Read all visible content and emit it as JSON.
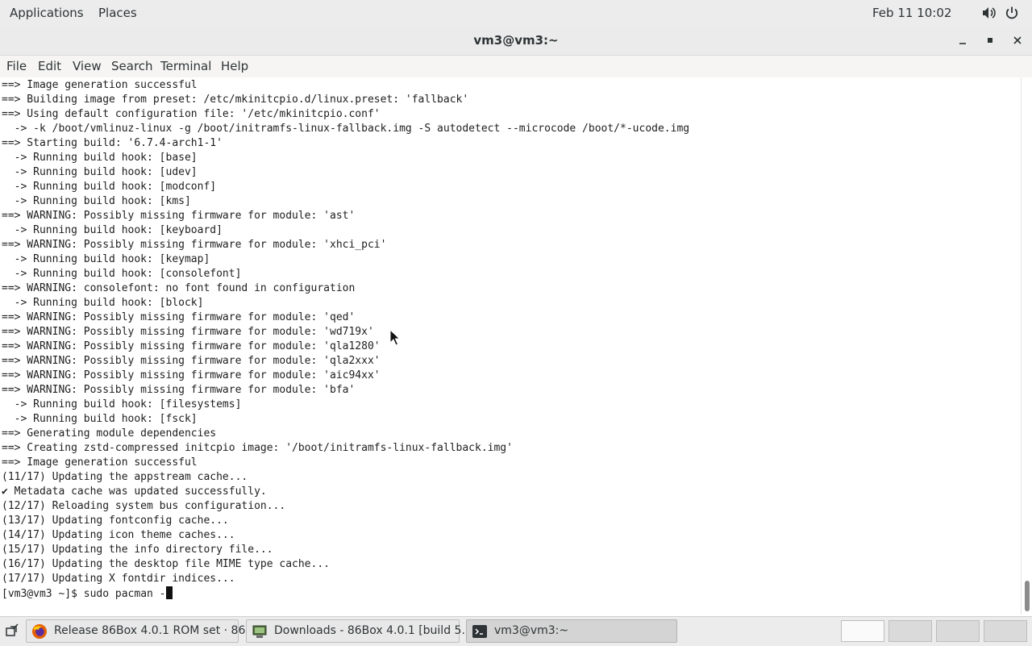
{
  "top_panel": {
    "applications": "Applications",
    "places": "Places",
    "clock": "Feb 11  10:02",
    "icons": [
      "volume-icon",
      "power-icon"
    ]
  },
  "window": {
    "title": "vm3@vm3:~",
    "buttons": [
      "minimize-icon",
      "maximize-icon",
      "close-icon"
    ]
  },
  "menubar": [
    "File",
    "Edit",
    "View",
    "Search",
    "Terminal",
    "Help"
  ],
  "terminal": {
    "lines": [
      "==> Image generation successful",
      "==> Building image from preset: /etc/mkinitcpio.d/linux.preset: 'fallback'",
      "==> Using default configuration file: '/etc/mkinitcpio.conf'",
      "  -> -k /boot/vmlinuz-linux -g /boot/initramfs-linux-fallback.img -S autodetect --microcode /boot/*-ucode.img",
      "==> Starting build: '6.7.4-arch1-1'",
      "  -> Running build hook: [base]",
      "  -> Running build hook: [udev]",
      "  -> Running build hook: [modconf]",
      "  -> Running build hook: [kms]",
      "==> WARNING: Possibly missing firmware for module: 'ast'",
      "  -> Running build hook: [keyboard]",
      "==> WARNING: Possibly missing firmware for module: 'xhci_pci'",
      "  -> Running build hook: [keymap]",
      "  -> Running build hook: [consolefont]",
      "==> WARNING: consolefont: no font found in configuration",
      "  -> Running build hook: [block]",
      "==> WARNING: Possibly missing firmware for module: 'qed'",
      "==> WARNING: Possibly missing firmware for module: 'wd719x'",
      "==> WARNING: Possibly missing firmware for module: 'qla1280'",
      "==> WARNING: Possibly missing firmware for module: 'qla2xxx'",
      "==> WARNING: Possibly missing firmware for module: 'aic94xx'",
      "==> WARNING: Possibly missing firmware for module: 'bfa'",
      "  -> Running build hook: [filesystems]",
      "  -> Running build hook: [fsck]",
      "==> Generating module dependencies",
      "==> Creating zstd-compressed initcpio image: '/boot/initramfs-linux-fallback.img'",
      "==> Image generation successful",
      "(11/17) Updating the appstream cache...",
      "✔ Metadata cache was updated successfully.",
      "(12/17) Reloading system bus configuration...",
      "(13/17) Updating fontconfig cache...",
      "(14/17) Updating icon theme caches...",
      "(15/17) Updating the info directory file...",
      "(16/17) Updating the desktop file MIME type cache...",
      "(17/17) Updating X fontdir indices..."
    ],
    "prompt": "[vm3@vm3 ~]$ ",
    "input": "sudo pacman -"
  },
  "taskbar": {
    "tasks": [
      {
        "label": "Release 86Box 4.0.1 ROM set · 86...",
        "icon": "firefox-icon"
      },
      {
        "label": "Downloads - 86Box 4.0.1 [build 5...",
        "icon": "86box-icon"
      },
      {
        "label": "vm3@vm3:~",
        "icon": "terminal-icon"
      }
    ],
    "workspaces": 4
  }
}
